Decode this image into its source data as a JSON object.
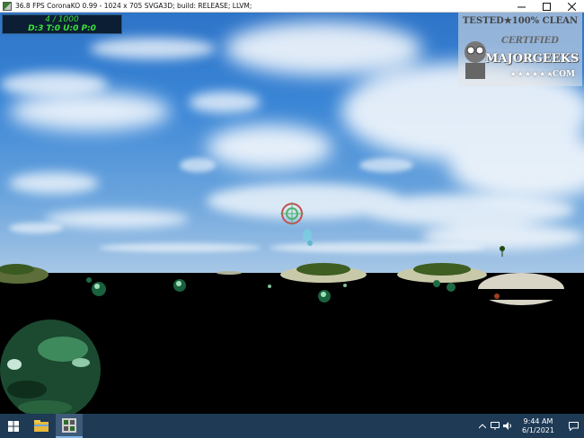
{
  "window": {
    "title": "36.8 FPS CoronaKO 0.99 - 1024 x 705 SVGA3D; build: RELEASE;  LLVM;"
  },
  "hud": {
    "progress": "4 / 1000",
    "stats": "D:3 T:0 U:0 P:0"
  },
  "watermark": {
    "line1": "TESTED★100% CLEAN",
    "line2": "CERTIFIED",
    "brand": "MAJORGEEKS",
    "stars": "★★★★★★",
    "domain": ".COM"
  },
  "taskbar": {
    "time": "9:44 AM",
    "date": "6/1/2021",
    "pinned": [
      "windows-start",
      "file-explorer",
      "coronako-app"
    ]
  },
  "colors": {
    "hud_text": "#39e23a",
    "hud_bg": "#0c1e33",
    "taskbar": "#1e3a55",
    "sky": "#3b86d6"
  }
}
